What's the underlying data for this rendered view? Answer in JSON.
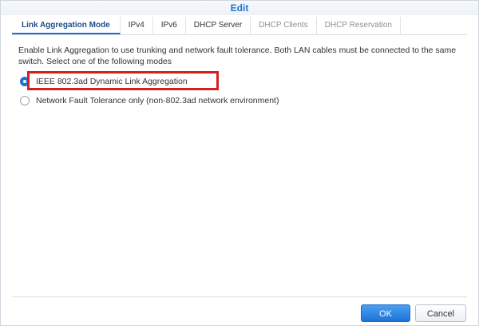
{
  "dialog": {
    "title": "Edit"
  },
  "tabs": [
    {
      "label": "Link Aggregation Mode",
      "state": "active"
    },
    {
      "label": "IPv4",
      "state": "normal"
    },
    {
      "label": "IPv6",
      "state": "normal"
    },
    {
      "label": "DHCP Server",
      "state": "normal"
    },
    {
      "label": "DHCP Clients",
      "state": "disabled"
    },
    {
      "label": "DHCP Reservation",
      "state": "disabled"
    }
  ],
  "content": {
    "description": "Enable Link Aggregation to use trunking and network fault tolerance. Both LAN cables must be connected to the same switch. Select one of the following modes",
    "options": [
      {
        "label": "IEEE 802.3ad Dynamic Link Aggregation",
        "selected": true
      },
      {
        "label": "Network Fault Tolerance only (non-802.3ad network environment)",
        "selected": false
      }
    ]
  },
  "footer": {
    "ok_label": "OK",
    "cancel_label": "Cancel"
  },
  "colors": {
    "accent": "#1e72d3",
    "highlight_border": "#d62020"
  }
}
